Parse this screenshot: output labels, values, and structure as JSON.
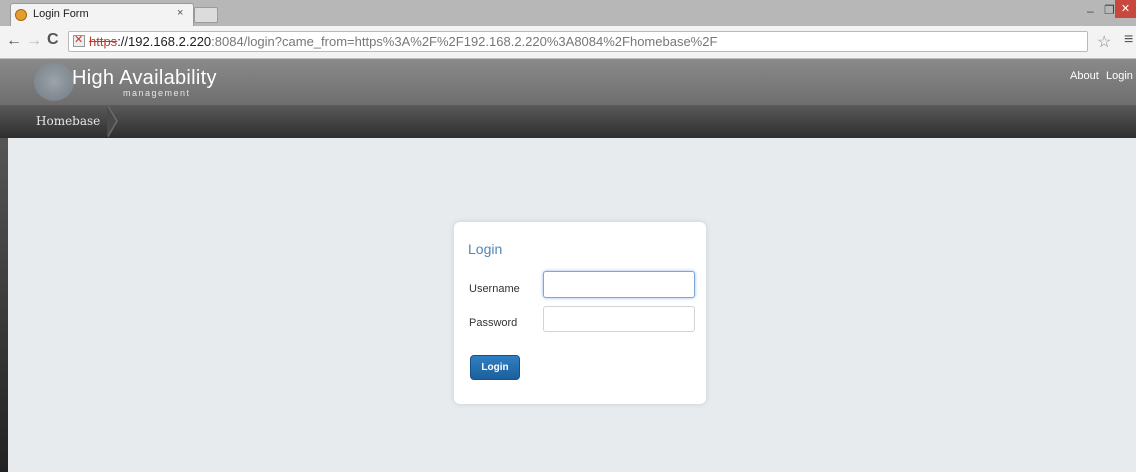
{
  "browser": {
    "tab_title": "Login Form",
    "tab_close": "×",
    "url_scheme": "https",
    "url_host": "://192.168.2.220",
    "url_rest": ":8084/login?came_from=https%3A%2F%2F192.168.2.220%3A8084%2Fhomebase%2F",
    "window_min": "–",
    "window_max": "❐",
    "window_close": "✕"
  },
  "header": {
    "title": "High Availability",
    "subtitle": "management",
    "nav": {
      "about": "About",
      "login": "Login"
    }
  },
  "breadcrumb": {
    "item": "Homebase"
  },
  "login": {
    "heading": "Login",
    "username_label": "Username",
    "password_label": "Password",
    "username_value": "",
    "password_value": "",
    "button": "Login"
  },
  "colors": {
    "accent": "#4f86b6",
    "button": "#1f6bab",
    "content_bg": "#e7ebee"
  },
  "icons": {
    "favicon": "globe-icon",
    "back": "arrow-left-icon",
    "forward": "arrow-right-icon",
    "reload": "reload-icon",
    "insecure": "broken-lock-icon",
    "star": "star-icon",
    "menu": "menu-icon",
    "logo": "hexagon-logo-icon"
  }
}
